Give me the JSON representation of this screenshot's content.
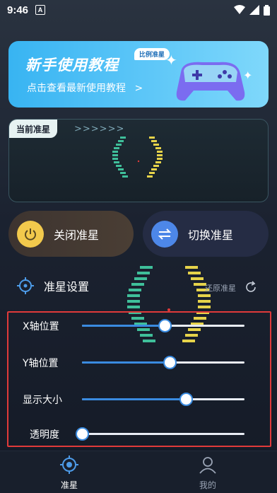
{
  "status_bar": {
    "time": "9:46",
    "badge": "A"
  },
  "banner": {
    "title": "新手使用教程",
    "tag": "比例准星",
    "subtitle": "点击查看最新使用教程",
    "arrow": ">"
  },
  "crosshair_card": {
    "tag": "当前准星",
    "chevrons": ">>>>>>"
  },
  "actions": {
    "close_label": "关闭准星",
    "switch_label": "切换准星"
  },
  "settings": {
    "title": "准星设置",
    "reset_label": "还原准星",
    "sliders": [
      {
        "label": "X轴位置",
        "value": 0.51
      },
      {
        "label": "Y轴位置",
        "value": 0.54
      },
      {
        "label": "显示大小",
        "value": 0.64
      },
      {
        "label": "透明度",
        "value": 0.0
      }
    ]
  },
  "bottom_nav": {
    "items": [
      {
        "label": "准星",
        "active": true
      },
      {
        "label": "我的",
        "active": false
      }
    ]
  },
  "colors": {
    "accent": "#3a8be0",
    "banner": "#4fc0f6",
    "highlight_box": "#e03a3a",
    "close_icon": "#f2c94c"
  }
}
